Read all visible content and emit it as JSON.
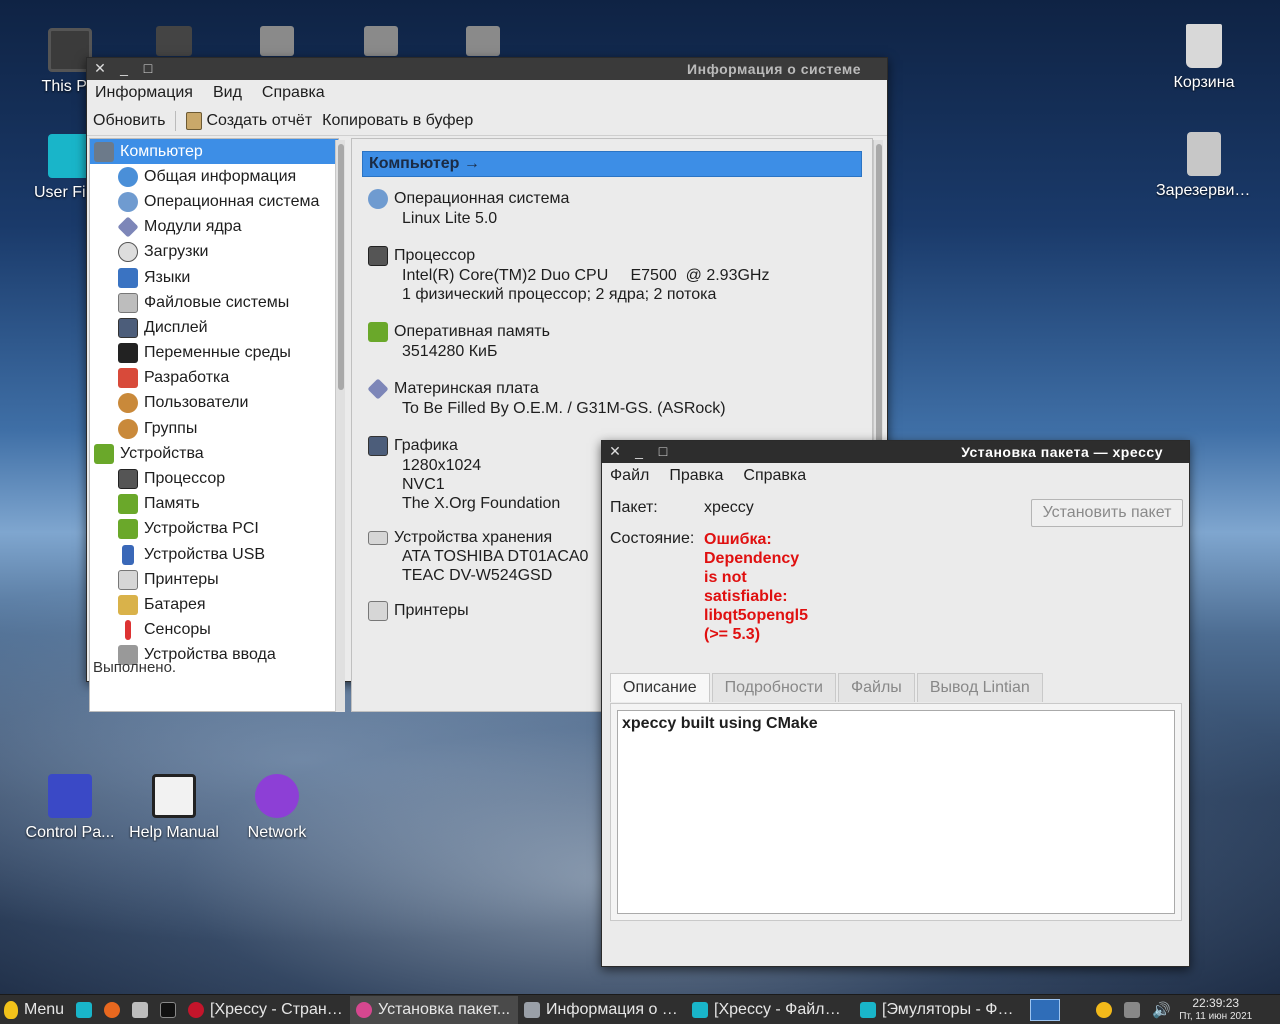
{
  "desktop": {
    "icons": [
      {
        "label": "This PC"
      },
      {
        "label": "User Files"
      },
      {
        "label": "Корзина"
      },
      {
        "label": "Зарезервиро..."
      },
      {
        "label": "Control Pa..."
      },
      {
        "label": "Help Manual"
      },
      {
        "label": "Network"
      }
    ]
  },
  "sysinfo": {
    "title": "Информация о системе",
    "menu": [
      "Информация",
      "Вид",
      "Справка"
    ],
    "toolbar": {
      "refresh": "Обновить",
      "report": "Создать отчёт",
      "copy": "Копировать в буфер"
    },
    "tree": [
      {
        "label": "Компьютер"
      },
      {
        "label": "Общая информация"
      },
      {
        "label": "Операционная система"
      },
      {
        "label": "Модули ядра"
      },
      {
        "label": "Загрузки"
      },
      {
        "label": "Языки"
      },
      {
        "label": "Файловые системы"
      },
      {
        "label": "Дисплей"
      },
      {
        "label": "Переменные среды"
      },
      {
        "label": "Разработка"
      },
      {
        "label": "Пользователи"
      },
      {
        "label": "Группы"
      },
      {
        "label": "Устройства"
      },
      {
        "label": "Процессор"
      },
      {
        "label": "Память"
      },
      {
        "label": "Устройства PCI"
      },
      {
        "label": "Устройства USB"
      },
      {
        "label": "Принтеры"
      },
      {
        "label": "Батарея"
      },
      {
        "label": "Сенсоры"
      },
      {
        "label": "Устройства ввода"
      }
    ],
    "header": "Компьютер →",
    "sections": [
      {
        "title": "Операционная система",
        "lines": [
          "Linux Lite 5.0"
        ]
      },
      {
        "title": "Процессор",
        "lines": [
          "Intel(R) Core(TM)2 Duo CPU     E7500  @ 2.93GHz",
          "1 физический процессор; 2 ядра; 2 потока"
        ]
      },
      {
        "title": "Оперативная память",
        "lines": [
          "3514280 КиБ"
        ]
      },
      {
        "title": "Материнская плата",
        "lines": [
          "To Be Filled By O.E.M. / G31M-GS. (ASRock)"
        ]
      },
      {
        "title": "Графика",
        "lines": [
          "1280x1024",
          "NVC1",
          "The X.Org Foundation"
        ]
      },
      {
        "title": "Устройства хранения",
        "lines": [
          "ATA TOSHIBA DT01ACA0",
          "TEAC DV-W524GSD"
        ]
      },
      {
        "title": "Принтеры",
        "lines": []
      }
    ],
    "status": "Выполнено."
  },
  "installer": {
    "title": "Установка пакета — xpeccy",
    "menu": [
      "Файл",
      "Правка",
      "Справка"
    ],
    "package_label": "Пакет:",
    "package_value": "xpeccy",
    "state_label": "Состояние:",
    "state_lines": [
      "Ошибка:",
      "Dependency",
      "is not",
      "satisfiable:",
      "libqt5opengl5",
      "(>= 5.3)"
    ],
    "install_button": "Установить пакет",
    "tabs": [
      "Описание",
      "Подробности",
      "Файлы",
      "Вывод Lintian"
    ],
    "description": "xpeccy built using CMake"
  },
  "taskbar": {
    "menu": "Menu",
    "tasks": [
      {
        "label": "[Xpeccy - Страниц..."
      },
      {
        "label": "Установка пакет..."
      },
      {
        "label": "Информация о с..."
      },
      {
        "label": "[Xpeccy - Файлов..."
      },
      {
        "label": "[Эмуляторы - Фай..."
      }
    ],
    "time": "22:39:23",
    "date": "Пт, 11 июн 2021"
  },
  "colors": {
    "accent": "#3d8ee6",
    "error": "#e01010",
    "titlebar": "#2d2d2d"
  }
}
